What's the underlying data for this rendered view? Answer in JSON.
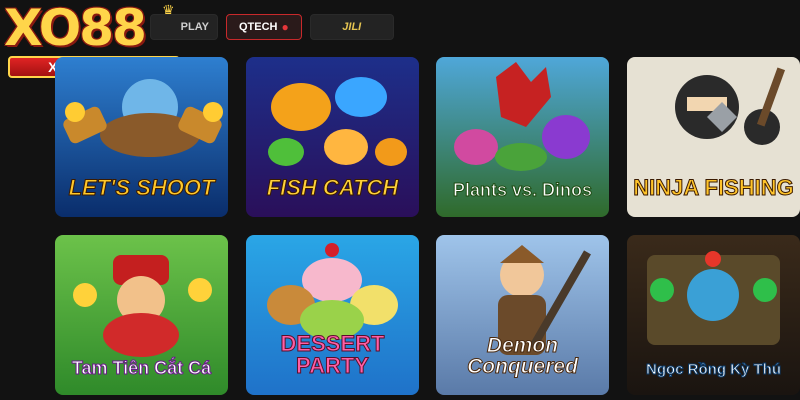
{
  "brand": {
    "logo_text": "XO88",
    "logo_url": "XO88US.COM"
  },
  "tabs": [
    {
      "label": "PLAY",
      "active": false
    },
    {
      "label": "QTECH",
      "active": true
    },
    {
      "label": "JILI",
      "active": false
    }
  ],
  "games": [
    {
      "title": "LET'S SHOOT"
    },
    {
      "title": "FISH CATCH"
    },
    {
      "title": "Plants vs. Dinos"
    },
    {
      "title": "NINJA FISHING"
    },
    {
      "title": "Tam Tiên Cắt Cá"
    },
    {
      "title": "DESSERT PARTY"
    },
    {
      "title": "Demon Conquered"
    },
    {
      "title": "Ngọc Rồng Kỳ Thú"
    }
  ],
  "colors": {
    "background": "#121212",
    "accent": "#c8292b",
    "gold": "#ffd54a"
  }
}
